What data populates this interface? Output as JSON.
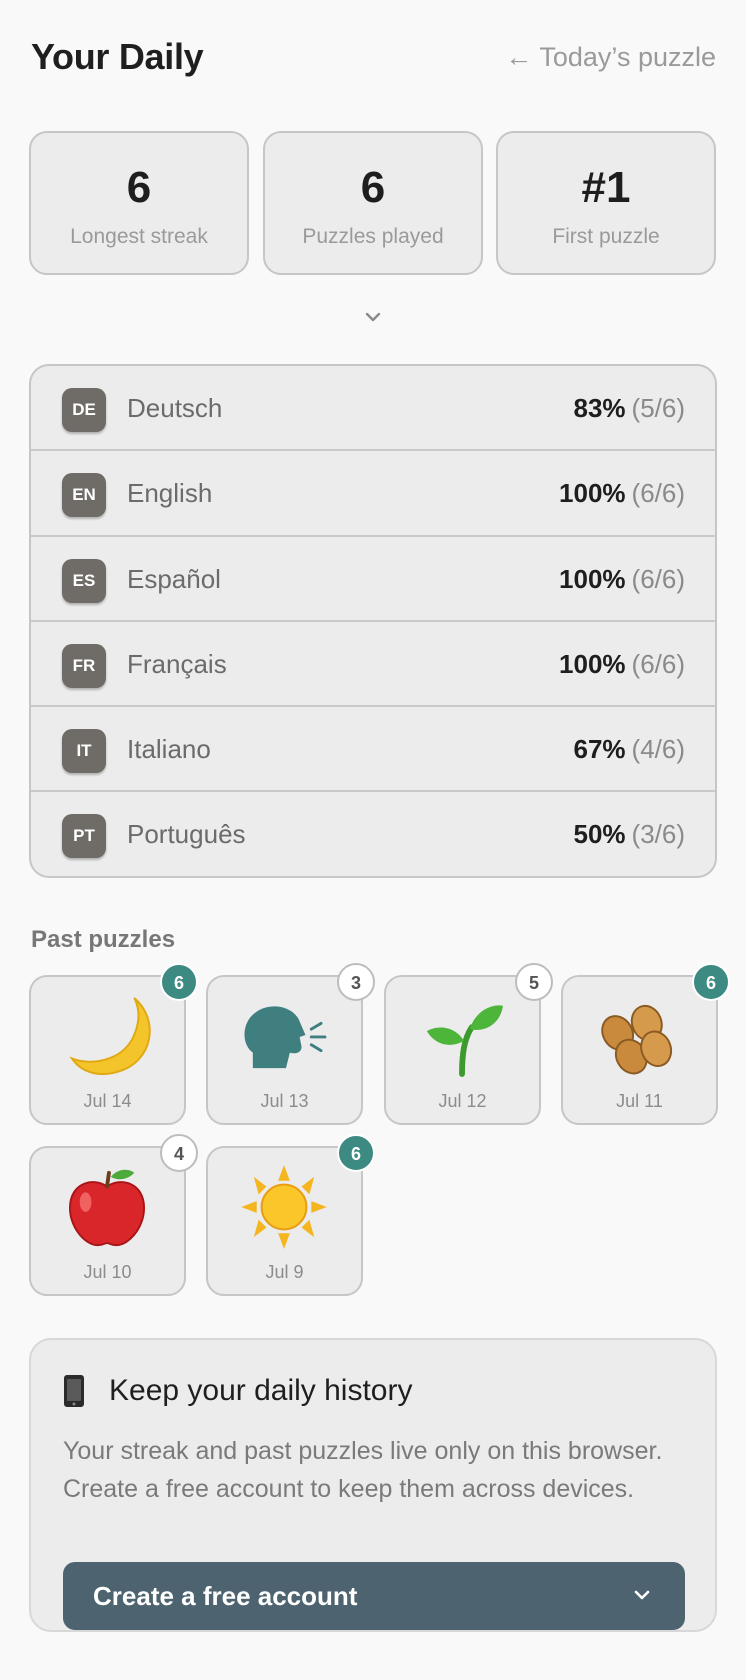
{
  "header": {
    "title": "Your Daily",
    "back_link": "← Today’s puzzle"
  },
  "stats": [
    {
      "value": "6",
      "label": "Longest streak"
    },
    {
      "value": "6",
      "label": "Puzzles played"
    },
    {
      "value": "#1",
      "label": "First puzzle"
    }
  ],
  "languages": [
    {
      "code": "DE",
      "name": "Deutsch",
      "percent": "83%",
      "fraction": "(5/6)"
    },
    {
      "code": "EN",
      "name": "English",
      "percent": "100%",
      "fraction": "(6/6)"
    },
    {
      "code": "ES",
      "name": "Español",
      "percent": "100%",
      "fraction": "(6/6)"
    },
    {
      "code": "FR",
      "name": "Français",
      "percent": "100%",
      "fraction": "(6/6)"
    },
    {
      "code": "IT",
      "name": "Italiano",
      "percent": "67%",
      "fraction": "(4/6)"
    },
    {
      "code": "PT",
      "name": "Português",
      "percent": "50%",
      "fraction": "(3/6)"
    }
  ],
  "past_puzzles": {
    "title": "Past puzzles",
    "items": [
      {
        "icon": "crescent-moon-icon",
        "date": "Jul 14",
        "score": "6"
      },
      {
        "icon": "speaking-head-icon",
        "date": "Jul 13",
        "score": "3"
      },
      {
        "icon": "seedling-icon",
        "date": "Jul 12",
        "score": "5"
      },
      {
        "icon": "peanuts-icon",
        "date": "Jul 11",
        "score": "6"
      },
      {
        "icon": "red-apple-icon",
        "date": "Jul 10",
        "score": "4"
      },
      {
        "icon": "sun-icon",
        "date": "Jul 9",
        "score": "6"
      }
    ]
  },
  "account": {
    "icon": "mobile-phone-icon",
    "title": "Keep your daily history",
    "text": "Your streak and past puzzles live only on this browser. Create a free account to keep them across devices.",
    "button_label": "Create a free account"
  },
  "colors": {
    "accent_teal": "#3c8a82",
    "button_slate": "#4d6470",
    "badge_gray": "#6f6b66"
  }
}
